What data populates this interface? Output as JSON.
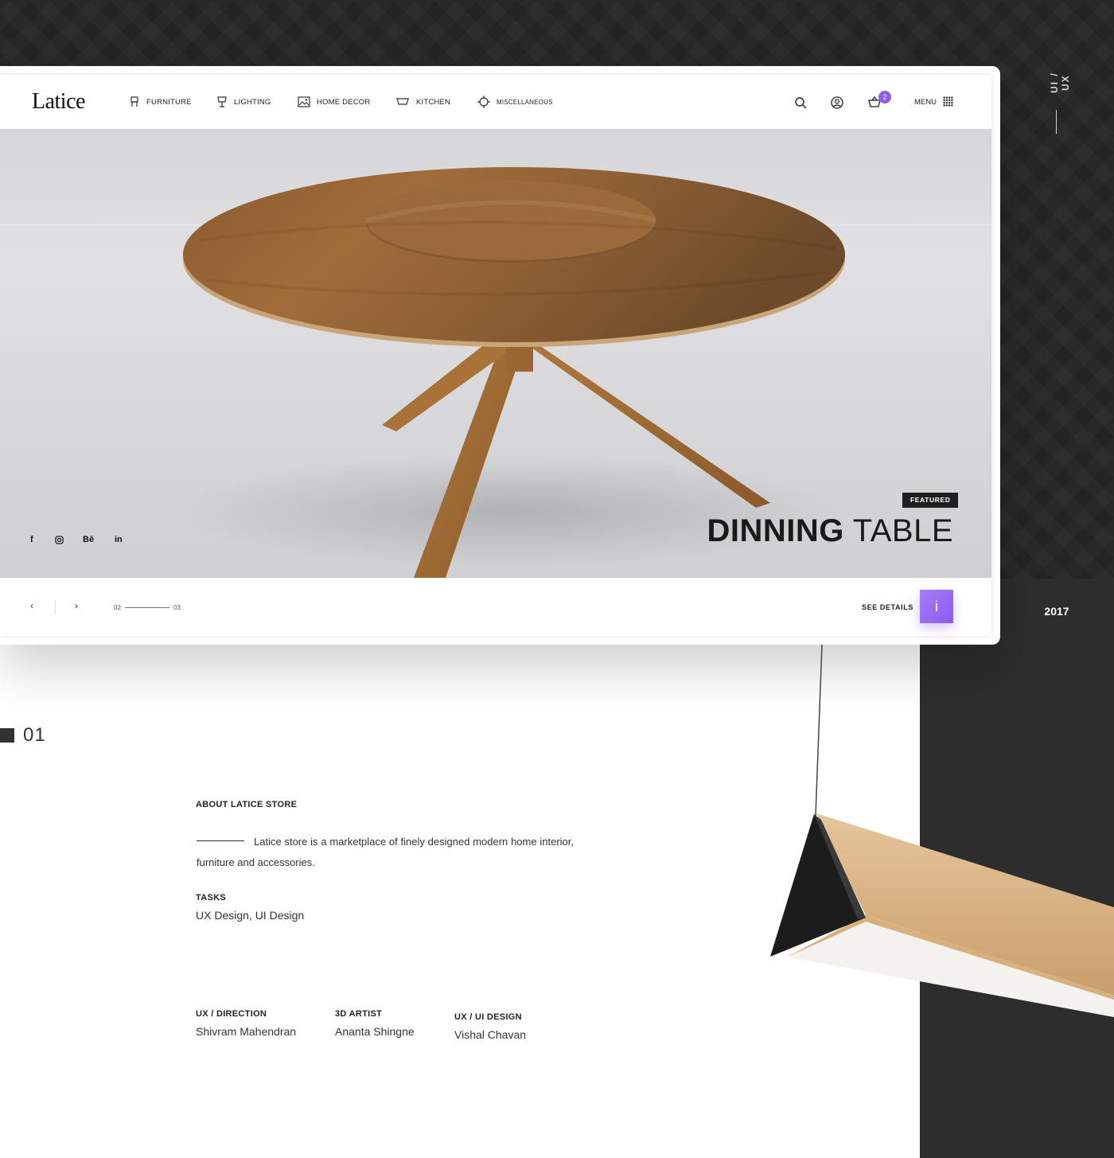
{
  "side": {
    "vertical_label": "UI / UX",
    "year": "2017"
  },
  "header": {
    "logo": "Latice",
    "nav": [
      {
        "label": "FURNITURE",
        "icon": "chair-icon"
      },
      {
        "label": "LIGHTING",
        "icon": "lamp-icon"
      },
      {
        "label": "HOME DECOR",
        "icon": "picture-icon"
      },
      {
        "label": "KITCHEN",
        "icon": "bowl-icon"
      },
      {
        "label": "MISCELLANEOUS",
        "icon": "compass-icon"
      }
    ],
    "cart_count": "2",
    "menu_label": "MENU"
  },
  "hero": {
    "badge": "FEATURED",
    "title_bold": "DINNING",
    "title_light": "TABLE",
    "social": [
      "f",
      "instagram-icon",
      "Bē",
      "in"
    ]
  },
  "footer": {
    "prev": "‹",
    "next": "›",
    "current_page": "02",
    "total_pages": "03",
    "see_details": "SEE DETAILS",
    "info_icon": "i"
  },
  "about": {
    "section_number": "01",
    "title": "ABOUT LATICE STORE",
    "description": "Latice store is a marketplace of finely designed modern home interior, furniture and accessories.",
    "tasks_label": "TASKS",
    "tasks_value": "UX Design, UI Design",
    "credits": [
      {
        "role": "UX / DIRECTION",
        "name": "Shivram Mahendran"
      },
      {
        "role": "3D ARTIST",
        "name": "Ananta Shingne"
      },
      {
        "role": "UX / UI DESIGN",
        "name": "Vishal Chavan"
      }
    ]
  },
  "colors": {
    "accent": "#8b5cf6",
    "dark": "#242424",
    "panel": "#2d2d2d"
  }
}
